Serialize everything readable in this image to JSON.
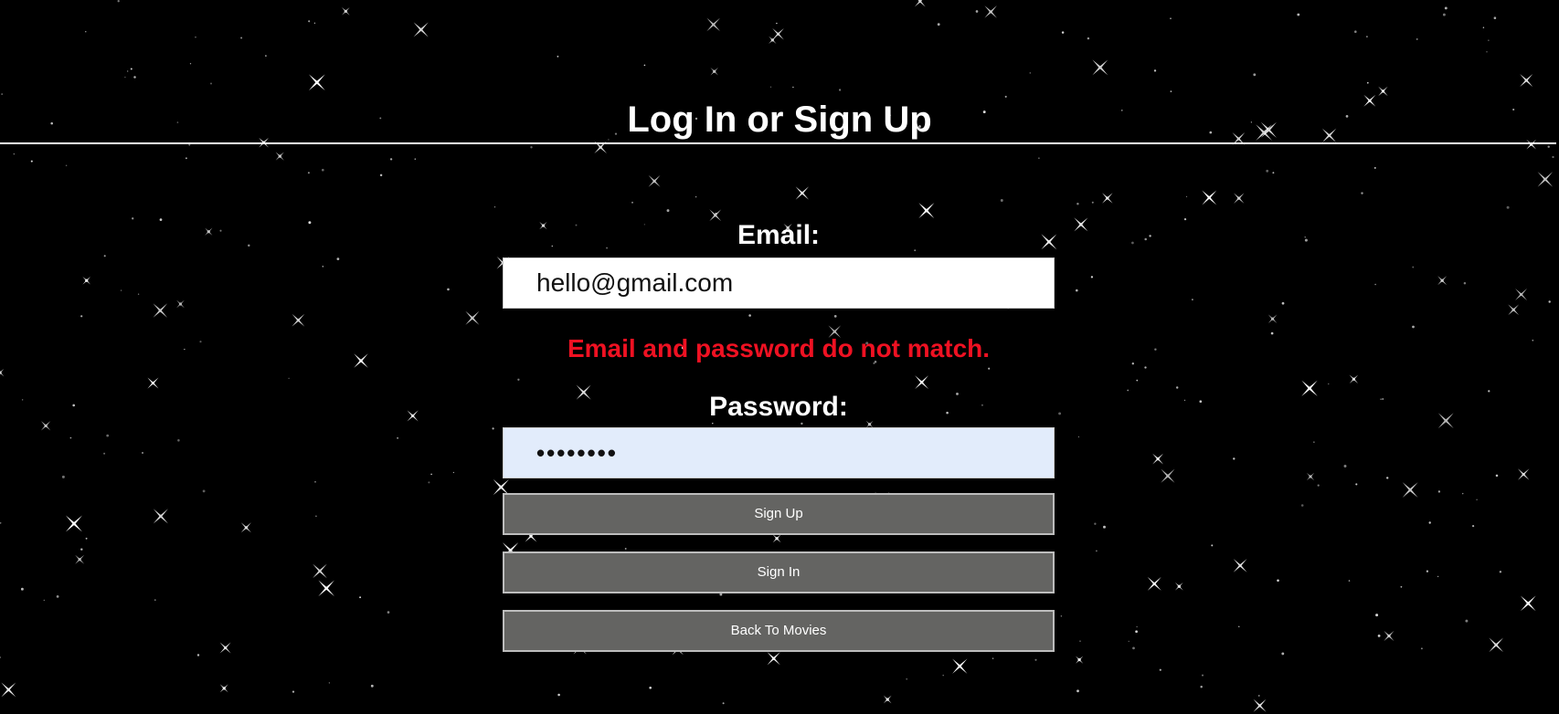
{
  "page": {
    "title": "Log In or Sign Up"
  },
  "form": {
    "email_label": "Email:",
    "email_value": "hello@gmail.com",
    "error_message": "Email and password do not match.",
    "password_label": "Password:",
    "password_value": "••••••••",
    "buttons": {
      "sign_up": "Sign Up",
      "sign_in": "Sign In",
      "back": "Back To Movies"
    }
  },
  "colors": {
    "background": "#000000",
    "error": "#ef1122",
    "button": "#646462",
    "password_field_bg": "#e2ecfb"
  }
}
